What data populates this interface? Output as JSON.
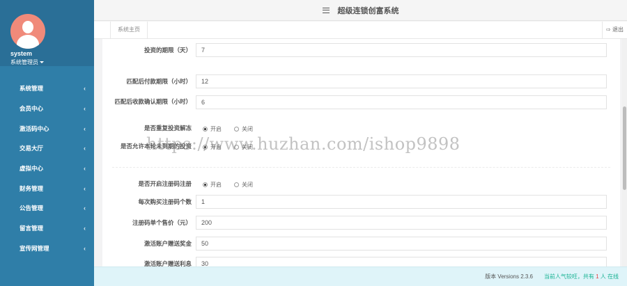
{
  "app": {
    "title": "超级连锁创富系统"
  },
  "user": {
    "name": "system",
    "role": "系统管理员"
  },
  "sidebar": {
    "items": [
      {
        "label": "系统管理"
      },
      {
        "label": "会员中心"
      },
      {
        "label": "激活码中心"
      },
      {
        "label": "交易大厅"
      },
      {
        "label": "虚拟中心"
      },
      {
        "label": "财务管理"
      },
      {
        "label": "公告管理"
      },
      {
        "label": "留言管理"
      },
      {
        "label": "宣传网管理"
      }
    ],
    "chevron": "‹"
  },
  "tabs": {
    "home": "系统主页",
    "logout": "退出"
  },
  "form": {
    "invest_period": {
      "label": "投资的期限（天）",
      "value": "7"
    },
    "pay_deadline": {
      "label": "匹配后付款期限（小时）",
      "value": "12"
    },
    "confirm_deadline": {
      "label": "匹配后收款确认期限（小时）",
      "value": "6"
    },
    "repeat_thaw": {
      "label": "是否重复投资解冻",
      "on": "开启",
      "off": "关闭",
      "selected": "on"
    },
    "allow_unexpired": {
      "label": "是否允许本轮未到期的投资",
      "on": "开启",
      "off": "关闭",
      "selected": "on"
    },
    "reg_code": {
      "label": "是否开启注册码注册",
      "on": "开启",
      "off": "关闭",
      "selected": "on"
    },
    "buy_count": {
      "label": "每次购买注册码个数",
      "value": "1"
    },
    "code_price": {
      "label": "注册码单个售价（元）",
      "value": "200"
    },
    "activate_bonus": {
      "label": "激活账户赠送奖金",
      "value": "50"
    },
    "activate_interest": {
      "label": "激活账户赠送利息",
      "value": "30"
    }
  },
  "footer": {
    "version": "版本 Versions 2.3.6",
    "online_prefix": "当前人气较旺，共有",
    "online_count": "1",
    "online_suffix": "人 在线"
  },
  "watermark": "https://www.huzhan.com/ishop9898",
  "colors": {
    "sidebar": "#2f7ea8",
    "accent": "#1ab394",
    "footer_bg": "#dff4f9"
  }
}
